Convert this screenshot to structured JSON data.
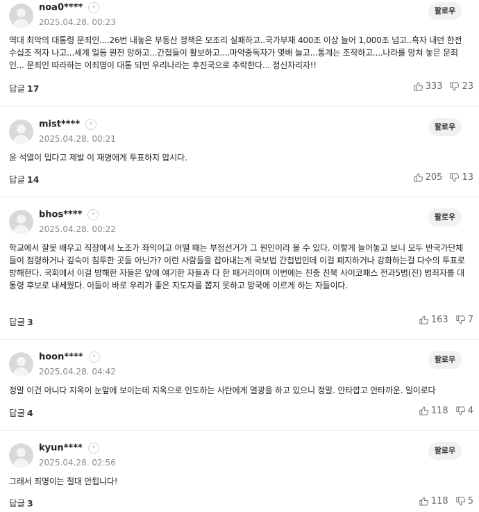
{
  "follow_label": "팔로우",
  "reply_label": "답글",
  "comments": [
    {
      "user": "noa0****",
      "date": "2025.04.28. 00:23",
      "text": "역대 최악의 대통령 문죄인....26번 내놓은 부동산 정책은 모조리 실패하고..국가부채 400조 이상 늘어 1,000조 넘고..흑자 내던 한전 수십조 적자 나고...세계 일등 원전 망하고...간첩들이 활보하고....마약중독자가 몇배 늘고...통계는 조작하고....나라를 망쳐 놓은 문죄인... 문죄인 따라하는 이죄명이 대통 되면 우리나라는 후진국으로 추락한다... 정신차리자!!",
      "replies": "17",
      "likes": "333",
      "dislikes": "23"
    },
    {
      "user": "mist****",
      "date": "2025.04.28. 00:21",
      "text": "윤 석열이 밉다고 제발 이 재명에게 투표하지 맙시다.",
      "replies": "14",
      "likes": "205",
      "dislikes": "13"
    },
    {
      "user": "bhos****",
      "date": "2025.04.28. 00:22",
      "text": "학교에서 잘못 배우고 직장에서 노조가 좌익이고 어떨 때는 부정선거가 그 원인이라 볼 수 있다. 이렇게 늘어놓고 보니 모두 반국가단체들이 점령하거나 깊숙이 침투한 곳들 아닌가? 이런 사람들을 잡아내는게 국보법 간첩법인데 이걸 폐지하거나 강화하는걸 다수의 투표로 방해한다. 국회에서 이걸 방해한 자들은 앞에 얘기한 자들과 다 한 패거리이며 이번에는 친중 친북 사이코패스 전과5범(진) 범죄자를 대통령 후보로 내세웠다. 이들이 바로 우리가 좋은 지도자를 뽑지 못하고 망국에 이르게 하는 자들이다.",
      "replies": "3",
      "likes": "163",
      "dislikes": "7"
    },
    {
      "user": "hoon****",
      "date": "2025.04.28. 04:42",
      "text": "정말 이건 아니다 지옥이 눈앞에 보이는데 지옥으로 인도하는 사탄에게 열광을 하고 있으니 정말. 안타깝고 안타까운. 일이로다",
      "replies": "4",
      "likes": "118",
      "dislikes": "4"
    },
    {
      "user": "kyun****",
      "date": "2025.04.28. 02:56",
      "text": "그래서 죄명이는 절대 안됩니다!",
      "replies": "3",
      "likes": "118",
      "dislikes": "5"
    }
  ]
}
